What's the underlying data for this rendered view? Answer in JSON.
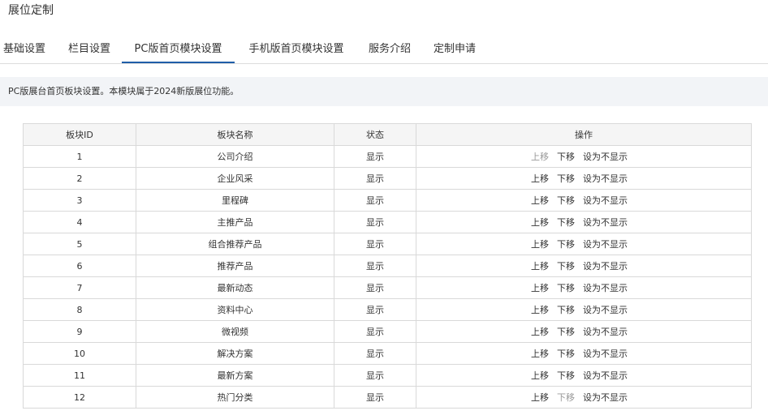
{
  "page": {
    "title": "展位定制"
  },
  "tabs": [
    {
      "label": "基础设置",
      "active": false
    },
    {
      "label": "栏目设置",
      "active": false
    },
    {
      "label": "PC版首页模块设置",
      "active": true
    },
    {
      "label": "手机版首页模块设置",
      "active": false
    },
    {
      "label": "服务介绍",
      "active": false
    },
    {
      "label": "定制申请",
      "active": false
    }
  ],
  "notice": {
    "text": "PC版展台首页板块设置。本模块属于2024新版展位功能。"
  },
  "table": {
    "headers": {
      "id": "板块ID",
      "name": "板块名称",
      "status": "状态",
      "actions": "操作"
    },
    "action_labels": {
      "up": "上移",
      "down": "下移",
      "hide": "设为不显示"
    },
    "colors": {
      "enabled": "#333333",
      "disabled": "#999999"
    },
    "rows": [
      {
        "id": "1",
        "name": "公司介绍",
        "status": "显示",
        "up_enabled": false,
        "down_enabled": true
      },
      {
        "id": "2",
        "name": "企业风采",
        "status": "显示",
        "up_enabled": true,
        "down_enabled": true
      },
      {
        "id": "3",
        "name": "里程碑",
        "status": "显示",
        "up_enabled": true,
        "down_enabled": true
      },
      {
        "id": "4",
        "name": "主推产品",
        "status": "显示",
        "up_enabled": true,
        "down_enabled": true
      },
      {
        "id": "5",
        "name": "组合推荐产品",
        "status": "显示",
        "up_enabled": true,
        "down_enabled": true
      },
      {
        "id": "6",
        "name": "推荐产品",
        "status": "显示",
        "up_enabled": true,
        "down_enabled": true
      },
      {
        "id": "7",
        "name": "最新动态",
        "status": "显示",
        "up_enabled": true,
        "down_enabled": true
      },
      {
        "id": "8",
        "name": "资料中心",
        "status": "显示",
        "up_enabled": true,
        "down_enabled": true
      },
      {
        "id": "9",
        "name": "微视频",
        "status": "显示",
        "up_enabled": true,
        "down_enabled": true
      },
      {
        "id": "10",
        "name": "解决方案",
        "status": "显示",
        "up_enabled": true,
        "down_enabled": true
      },
      {
        "id": "11",
        "name": "最新方案",
        "status": "显示",
        "up_enabled": true,
        "down_enabled": true
      },
      {
        "id": "12",
        "name": "热门分类",
        "status": "显示",
        "up_enabled": true,
        "down_enabled": false
      }
    ]
  }
}
